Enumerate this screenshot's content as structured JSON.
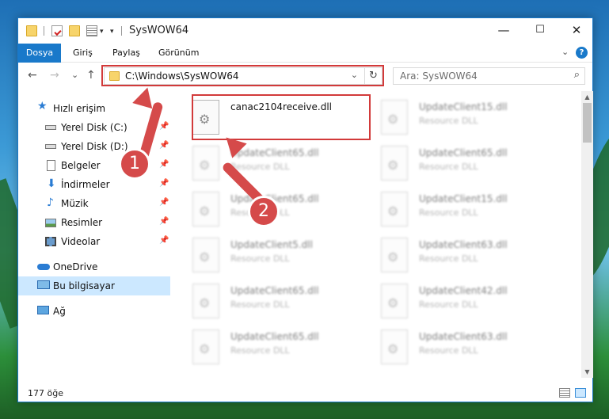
{
  "window": {
    "title": "SysWOW64",
    "minimize": "—",
    "maximize": "☐",
    "close": "✕"
  },
  "ribbon": {
    "tabs": [
      "Dosya",
      "Giriş",
      "Paylaş",
      "Görünüm"
    ],
    "collapse": "⌄",
    "help": "?"
  },
  "nav": {
    "back": "←",
    "forward": "→",
    "recent": "⌄",
    "up": "↑",
    "address": "C:\\Windows\\SysWOW64",
    "address_dropdown": "⌄",
    "refresh": "↻",
    "search_placeholder": "Ara: SysWOW64",
    "search_icon": "⌕"
  },
  "sidebar": {
    "quick_access": "Hızlı erişim",
    "items": [
      {
        "label": "Yerel Disk (C:)",
        "icon": "drive-icon"
      },
      {
        "label": "Yerel Disk (D:)",
        "icon": "drive-icon"
      },
      {
        "label": "Belgeler",
        "icon": "documents-icon"
      },
      {
        "label": "İndirmeler",
        "icon": "downloads-icon"
      },
      {
        "label": "Müzik",
        "icon": "music-icon"
      },
      {
        "label": "Resimler",
        "icon": "pictures-icon"
      },
      {
        "label": "Videolar",
        "icon": "videos-icon"
      }
    ],
    "onedrive": "OneDrive",
    "this_pc": "Bu bilgisayar",
    "network": "Ağ"
  },
  "files": {
    "highlighted": {
      "name": "canac2104receive.dll"
    },
    "left_column": [
      {
        "name": "UpdateClient65.dll",
        "type": "Resource DLL"
      },
      {
        "name": "UpdateClient65.dll",
        "type": "Resource DLL"
      },
      {
        "name": "UpdateClient5.dll",
        "type": "Resource DLL"
      },
      {
        "name": "UpdateClient65.dll",
        "type": "Resource DLL"
      },
      {
        "name": "UpdateClient65.dll",
        "type": "Resource DLL"
      }
    ],
    "right_column": [
      {
        "name": "UpdateClient15.dll",
        "type": "Resource DLL"
      },
      {
        "name": "UpdateClient65.dll",
        "type": "Resource DLL"
      },
      {
        "name": "UpdateClient15.dll",
        "type": "Resource DLL"
      },
      {
        "name": "UpdateClient63.dll",
        "type": "Resource DLL"
      },
      {
        "name": "UpdateClient42.dll",
        "type": "Resource DLL"
      },
      {
        "name": "UpdateClient63.dll",
        "type": "Resource DLL"
      }
    ]
  },
  "status": {
    "item_count": "177 öğe"
  },
  "annotations": {
    "step1": "1",
    "step2": "2",
    "color": "#d54a4a"
  }
}
